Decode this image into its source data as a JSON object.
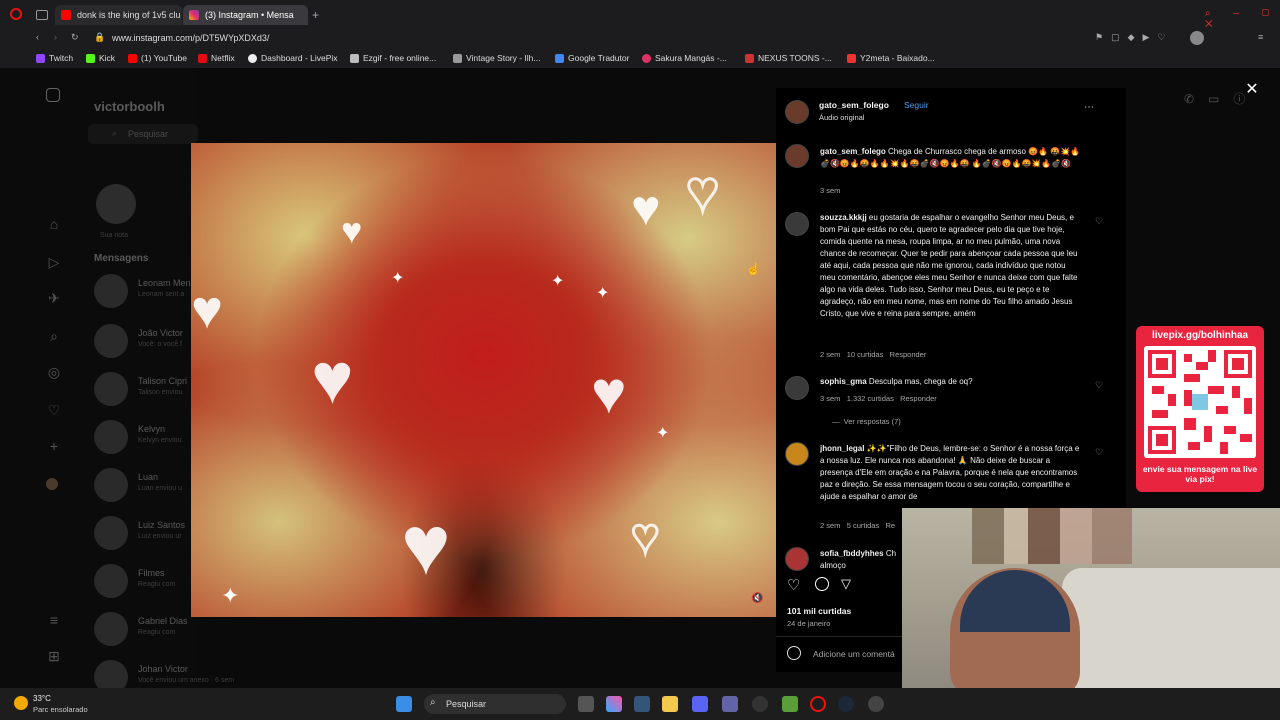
{
  "browser": {
    "tabs": [
      {
        "label": "donk is the king of 1v5 clu"
      },
      {
        "label": "(3) Instagram • Mensa"
      }
    ],
    "url": "www.instagram.com/p/DT5WYpXDXd3/",
    "bookmarks": [
      "Twitch",
      "Kick",
      "(1) YouTube",
      "Netflix",
      "Dashboard - LivePix",
      "Ezgif - free online...",
      "Vintage Story - Ilh...",
      "Google Tradutor",
      "Sakura Mangás -...",
      "NEXUS TOONS -...",
      "Y2meta - Baixado..."
    ]
  },
  "instagram_bg": {
    "username": "victorboolh",
    "search_placeholder": "Pesquisar",
    "note_label": "Sua nota",
    "messages_heading": "Mensagens",
    "conversations": [
      {
        "name": "Leonam Men",
        "preview": "Leonam sent a"
      },
      {
        "name": "João Victor",
        "preview": "Você: o você f"
      },
      {
        "name": "Talison Cipri",
        "preview": "Talison enviou"
      },
      {
        "name": "Kelvyn",
        "preview": "Kelvyn enviou"
      },
      {
        "name": "Luan",
        "preview": "Luan enviou u"
      },
      {
        "name": "Luiz Santos",
        "preview": "Luiz enviou ur"
      },
      {
        "name": "Filmes",
        "preview": "Reagiu com"
      },
      {
        "name": "Gabriel Dias",
        "preview": "Reagiu com"
      },
      {
        "name": "Johan Victor",
        "preview": "Você enviou um anexo · 6 sem"
      }
    ]
  },
  "post": {
    "author": "gato_sem_folego",
    "follow_label": "Seguir",
    "audio": "Áudio original",
    "caption": {
      "user": "gato_sem_folego",
      "text": "Chega de Churrasco chega de armoso 😡🔥 🤬💥🔥💣🔇😡🔥🤬🔥🔥💥🔥🤬💣🔇😡🔥🤬 🔥💣🔇😡🔥🤬💥🔥💣🔇",
      "time": "3 sem"
    },
    "comments": [
      {
        "user": "souzza.kkkjj",
        "text": "eu gostaria de espalhar o evangelho Senhor meu Deus, e bom Pai que estás no céu, quero te agradecer pelo dia que tive hoje, comida quente na mesa, roupa limpa, ar no meu pulmão, uma nova chance de recomeçar. Quer te pedir para abençoar cada pessoa que leu até aqui, cada pessoa que não me ignorou, cada indivíduo que notou meu comentário, abençoe eles meu Senhor e nunca deixe com que falte algo na vida deles. Tudo isso, Senhor meu Deus, eu te peço e te agradeço, não em meu nome, mas em nome do Teu filho amado Jesus Cristo, que vive e reina para sempre, amém",
        "time": "2 sem",
        "likes": "10 curtidas",
        "reply": "Responder"
      },
      {
        "user": "sophis_gma",
        "text": "Desculpa mas, chega de oq?",
        "time": "3 sem",
        "likes": "1.332 curtidas",
        "reply": "Responder",
        "replies": "Ver respostas (7)"
      },
      {
        "user": "jhonn_legal",
        "text": "✨✨\"Filho de Deus, lembre-se: o Senhor é a nossa força e a nossa luz. Ele nunca nos abandona! 🙏 Não deixe de buscar a presença d'Ele em oração e na Palavra, porque é nela que encontramos paz e direção. Se essa mensagem tocou o seu coração, compartilhe e ajude a espalhar o amor de",
        "time": "2 sem",
        "likes": "5 curtidas",
        "reply": "Re"
      },
      {
        "user": "sofia_fbddyhhes",
        "text": "Ch almoço",
        "time": "",
        "likes": "",
        "reply": ""
      }
    ],
    "likes_total": "101 mil curtidas",
    "date": "24 de janeiro",
    "comment_placeholder": "Adicione um comentá"
  },
  "overlay_qr": {
    "url_label": "livepix.gg/bolhinhaa",
    "cta": "envie sua mensagem na live via pix!"
  },
  "taskbar": {
    "weather_temp": "33°C",
    "weather_desc": "Parc ensolarado",
    "search_label": "Pesquisar"
  }
}
